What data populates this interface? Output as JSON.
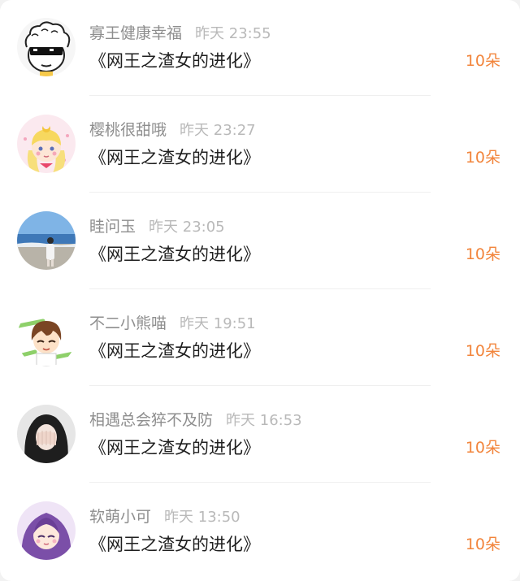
{
  "records": [
    {
      "name": "寡王健康幸福",
      "time": "昨天 23:55",
      "gift": "《网王之渣女的进化》",
      "amount": "10朵",
      "avatar_icon": "sunglasses-cartoon-avatar"
    },
    {
      "name": "樱桃很甜哦",
      "time": "昨天 23:27",
      "gift": "《网王之渣女的进化》",
      "amount": "10朵",
      "avatar_icon": "sailor-moon-avatar"
    },
    {
      "name": "眭问玉",
      "time": "昨天 23:05",
      "gift": "《网王之渣女的进化》",
      "amount": "10朵",
      "avatar_icon": "beach-photo-avatar"
    },
    {
      "name": "不二小熊喵",
      "time": "昨天 19:51",
      "gift": "《网王之渣女的进化》",
      "amount": "10朵",
      "avatar_icon": "anime-boy-avatar"
    },
    {
      "name": "相遇总会猝不及防",
      "time": "昨天 16:53",
      "gift": "《网王之渣女的进化》",
      "amount": "10朵",
      "avatar_icon": "girl-covering-face-avatar"
    },
    {
      "name": "软萌小可",
      "time": "昨天 13:50",
      "gift": "《网王之渣女的进化》",
      "amount": "10朵",
      "avatar_icon": "anime-girl-avatar"
    }
  ],
  "colors": {
    "amount": "#f2853c",
    "name": "#8e8e8e",
    "time": "#b9b9b9",
    "title": "#1f1f1f"
  }
}
